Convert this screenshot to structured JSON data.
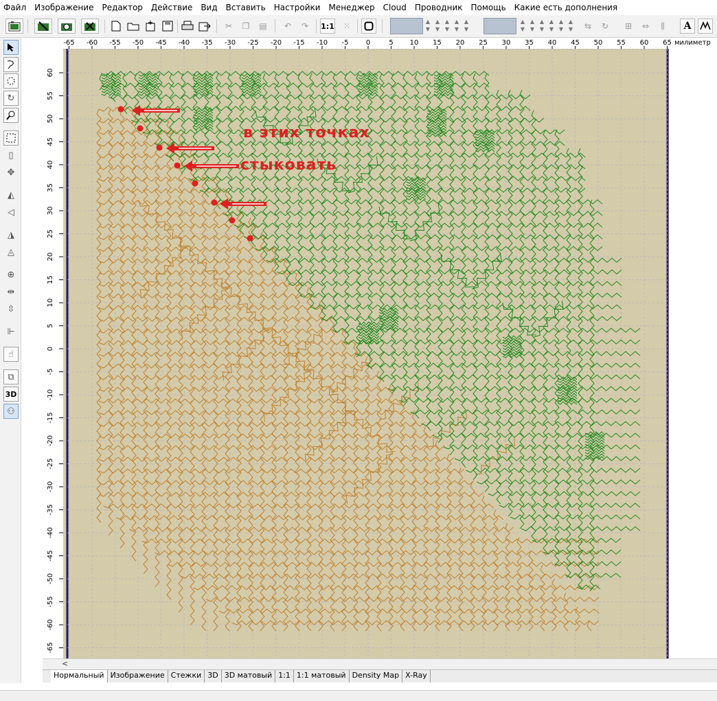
{
  "menu": [
    "Файл",
    "Изображение",
    "Редактор",
    "Действие",
    "Вид",
    "Вставить",
    "Настройки",
    "Менеджер",
    "Cloud",
    "Проводник",
    "Помощь",
    "Какие есть дополнения"
  ],
  "toolbar": {
    "font_bold_label": "A",
    "scale_label": "1:1",
    "icons": [
      "open-design-icon",
      "stitch-tool-icon",
      "camera-icon",
      "check-icon",
      "new-file-icon",
      "open-folder-icon",
      "insert-icon",
      "print-icon",
      "export-icon",
      "cut-icon",
      "copy-icon",
      "paste-icon",
      "undo-icon",
      "redo-icon",
      "zoom-1-1-icon",
      "select-all-icon",
      "stop-icon",
      "mirror-icon",
      "rotate-icon",
      "align-icon",
      "spacing-icon",
      "font-icon",
      "monogram-icon"
    ],
    "color_box_1": "#b8c3d1",
    "color_box_2": "#b8c3d1"
  },
  "left_tools": [
    "pointer-arrow-icon",
    "lasso-icon",
    "circle-select-icon",
    "rotate-icon",
    "zoom-icon",
    "rectangle-select-icon",
    "page-icon",
    "move-icon",
    "mirror-h-icon",
    "mirror-v-icon",
    "flip-icon",
    "flip-2-icon",
    "center-icon",
    "spread-h-icon",
    "spread-v-icon",
    "align-icon",
    "hand-pointer-icon",
    "frame-icon",
    "view-3d-icon",
    "person-icon"
  ],
  "left_tools_3d_label": "3D",
  "ruler": {
    "unit": "милиметр",
    "h_ticks": [
      "-65",
      "-60",
      "-55",
      "-50",
      "-45",
      "-40",
      "-35",
      "-30",
      "-25",
      "-20",
      "-15",
      "-10",
      "-5",
      "0",
      "5",
      "10",
      "15",
      "20",
      "25",
      "30",
      "35",
      "40",
      "45",
      "50",
      "55",
      "60",
      "65"
    ],
    "v_ticks": [
      "60",
      "55",
      "50",
      "45",
      "40",
      "35",
      "30",
      "25",
      "20",
      "15",
      "10",
      "5",
      "0",
      "-5",
      "-10",
      "-15",
      "-20",
      "-25",
      "-30",
      "-35",
      "-40",
      "-45",
      "-50",
      "-55",
      "-60",
      "-65"
    ]
  },
  "annotation": {
    "line1": "в этих точках",
    "line2": "стыковать",
    "color": "#e02020"
  },
  "design": {
    "green_color": "#1e8a1e",
    "orange_color": "#c0812e",
    "canvas_color": "#d4cbaa"
  },
  "tabs": [
    "Нормальный",
    "Изображение",
    "Стежки",
    "3D",
    "3D матовый",
    "1:1",
    "1:1 матовый",
    "Density Map",
    "X-Ray"
  ],
  "scroll_arrow": "<"
}
